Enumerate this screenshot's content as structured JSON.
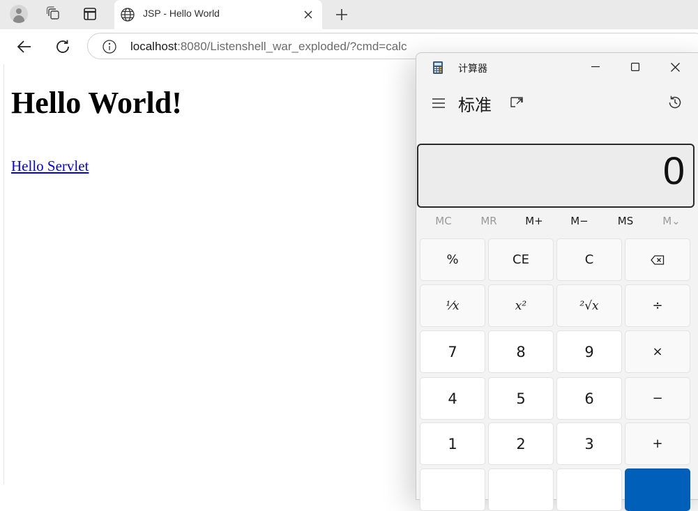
{
  "browser": {
    "tab_title": "JSP - Hello World",
    "url_host": "localhost",
    "url_rest": ":8080/Listenshell_war_exploded/?cmd=calc"
  },
  "page": {
    "heading": "Hello World!",
    "link": "Hello Servlet"
  },
  "calculator": {
    "window_title": "计算器",
    "mode": "标准",
    "display": "0",
    "memory": [
      "MC",
      "MR",
      "M+",
      "M−",
      "MS",
      "M⌄"
    ],
    "keys": {
      "percent": "%",
      "ce": "CE",
      "c": "C",
      "reciprocal": "¹⁄x",
      "square": "x²",
      "sqrt": "²√x",
      "divide": "÷",
      "seven": "7",
      "eight": "8",
      "nine": "9",
      "multiply": "×",
      "four": "4",
      "five": "5",
      "six": "6",
      "minus": "−",
      "one": "1",
      "two": "2",
      "three": "3",
      "plus": "+"
    },
    "accent_color": "#005fb8"
  }
}
